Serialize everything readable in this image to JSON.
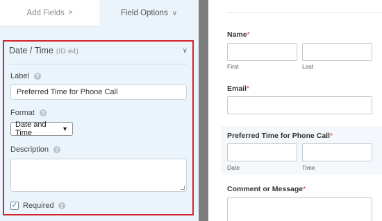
{
  "tabs": {
    "add_fields": "Add Fields",
    "add_fields_chevron": ">",
    "field_options": "Field Options",
    "field_options_chevron": "∨"
  },
  "field": {
    "title": "Date / Time",
    "id_label": "(ID #4)",
    "collapse_chevron": "∨",
    "label_caption": "Label",
    "label_value": "Preferred Time for Phone Call",
    "format_caption": "Format",
    "format_value": "Date and Time",
    "description_caption": "Description",
    "description_value": "",
    "required_caption": "Required",
    "required_checked": true,
    "help_glyph": "?"
  },
  "preview": {
    "name_label": "Name",
    "first_sub": "First",
    "last_sub": "Last",
    "email_label": "Email",
    "time_label": "Preferred Time for Phone Call",
    "date_sub": "Date",
    "time_sub": "Time",
    "comment_label": "Comment or Message",
    "required_star": "*"
  },
  "colors": {
    "highlight_border": "#d2232a",
    "panel_bg": "#ebf3fb",
    "gutter": "#7d7d7d",
    "required_star": "#d63638"
  }
}
